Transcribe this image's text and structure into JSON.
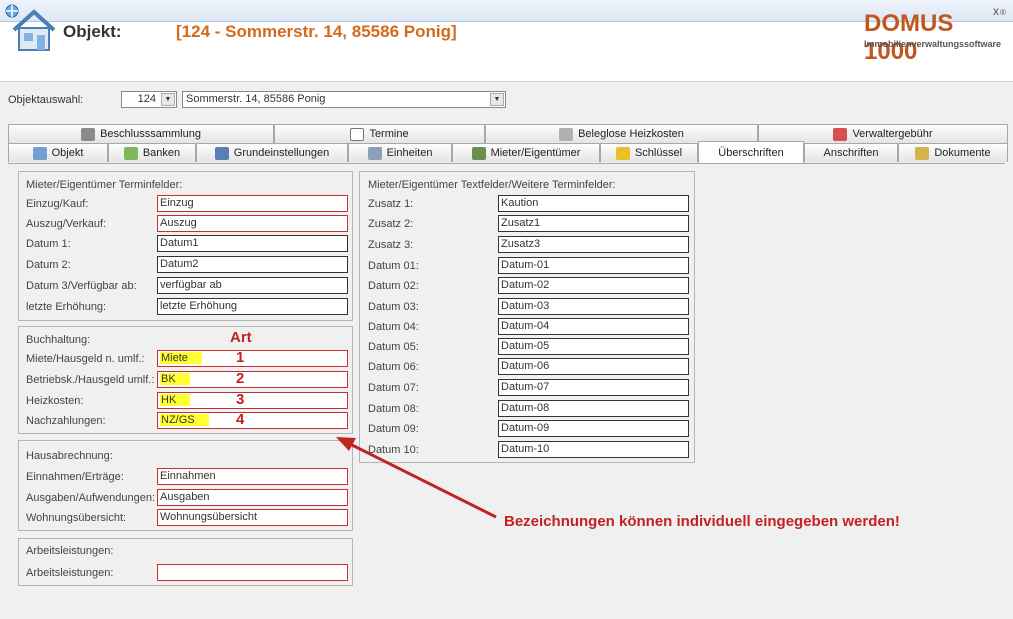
{
  "window": {
    "close_glyph": "x"
  },
  "header": {
    "label": "Objekt:",
    "value": "[124 - Sommerstr. 14, 85586 Ponig]",
    "logo_main": "DOMUS 1000",
    "logo_reg": "®",
    "logo_sub": "Immobilienverwaltungssoftware",
    "brand_color": "#c2561f"
  },
  "selection": {
    "label": "Objektauswahl:",
    "number": "124",
    "name": "Sommerstr. 14, 85586 Ponig"
  },
  "tabs_top": [
    {
      "label": "Beschlusssammlung",
      "icon": "gavel-icon"
    },
    {
      "label": "Termine",
      "icon": "calendar-icon"
    },
    {
      "label": "Beleglose Heizkosten",
      "icon": "paperclip-icon"
    },
    {
      "label": "Verwaltergebühr",
      "icon": "edit-icon"
    }
  ],
  "tabs_bottom": [
    {
      "label": "Objekt",
      "icon": "house-icon"
    },
    {
      "label": "Banken",
      "icon": "money-icon"
    },
    {
      "label": "Grundeinstellungen",
      "icon": "network-icon"
    },
    {
      "label": "Einheiten",
      "icon": "building-icon"
    },
    {
      "label": "Mieter/Eigentümer",
      "icon": "people-icon"
    },
    {
      "label": "Schlüssel",
      "icon": "key-icon"
    },
    {
      "label": "Überschriften",
      "icon": ""
    },
    {
      "label": "Anschriften",
      "icon": ""
    },
    {
      "label": "Dokumente",
      "icon": "documents-icon"
    }
  ],
  "termin": {
    "title": "Mieter/Eigentümer Terminfelder:",
    "rows": [
      {
        "label": "Einzug/Kauf:",
        "value": "Einzug"
      },
      {
        "label": "Auszug/Verkauf:",
        "value": "Auszug"
      },
      {
        "label": "Datum 1:",
        "value": "Datum1"
      },
      {
        "label": "Datum 2:",
        "value": "Datum2"
      },
      {
        "label": "Datum 3/Verfügbar ab:",
        "value": "verfügbar ab"
      },
      {
        "label": "letzte Erhöhung:",
        "value": "letzte Erhöhung"
      }
    ]
  },
  "buchhaltung": {
    "title": "Buchhaltung:",
    "art_header": "Art",
    "rows": [
      {
        "label": "Miete/Hausgeld n. umlf.:",
        "value": "Miete",
        "art": "1"
      },
      {
        "label": "Betriebsk./Hausgeld umlf.:",
        "value": "BK",
        "art": "2"
      },
      {
        "label": "Heizkosten:",
        "value": "HK",
        "art": "3"
      },
      {
        "label": "Nachzahlungen:",
        "value": "NZ/GS",
        "art": "4"
      }
    ]
  },
  "hausabrechnung": {
    "title": "Hausabrechnung:",
    "rows": [
      {
        "label": "Einnahmen/Erträge:",
        "value": "Einnahmen"
      },
      {
        "label": "Ausgaben/Aufwendungen:",
        "value": "Ausgaben"
      },
      {
        "label": "Wohnungsübersicht:",
        "value": "Wohnungsübersicht"
      }
    ]
  },
  "arbeit": {
    "title": "Arbeitsleistungen:",
    "rows": [
      {
        "label": "Arbeitsleistungen:",
        "value": ""
      }
    ]
  },
  "textfelder": {
    "title": "Mieter/Eigentümer Textfelder/Weitere Terminfelder:",
    "rows": [
      {
        "label": "Zusatz 1:",
        "value": "Kaution"
      },
      {
        "label": "Zusatz 2:",
        "value": "Zusatz1"
      },
      {
        "label": "Zusatz 3:",
        "value": "Zusatz3"
      },
      {
        "label": "Datum 01:",
        "value": "Datum-01"
      },
      {
        "label": "Datum 02:",
        "value": "Datum-02"
      },
      {
        "label": "Datum 03:",
        "value": "Datum-03"
      },
      {
        "label": "Datum 04:",
        "value": "Datum-04"
      },
      {
        "label": "Datum 05:",
        "value": "Datum-05"
      },
      {
        "label": "Datum 06:",
        "value": "Datum-06"
      },
      {
        "label": "Datum 07:",
        "value": "Datum-07"
      },
      {
        "label": "Datum 08:",
        "value": "Datum-08"
      },
      {
        "label": "Datum 09:",
        "value": "Datum-09"
      },
      {
        "label": "Datum 10:",
        "value": "Datum-10"
      }
    ]
  },
  "annotation": {
    "text": "Bezeichnungen können individuell eingegeben werden!",
    "color": "#c22222"
  },
  "colors": {
    "field_border_red": "#c23030",
    "highlight": "#ffff33"
  }
}
